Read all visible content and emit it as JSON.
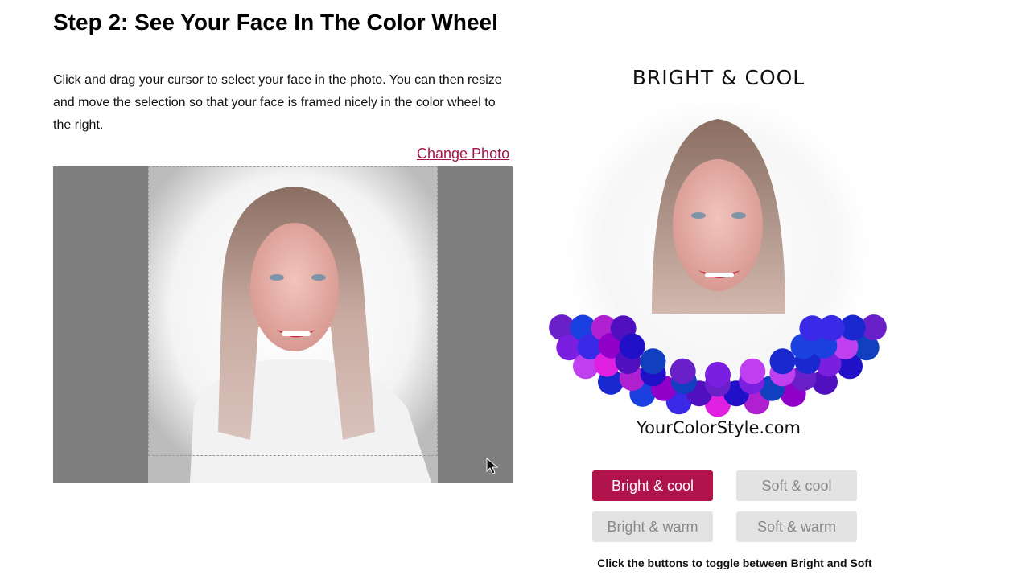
{
  "header": {
    "title": "Step 2: See Your Face In The Color Wheel",
    "instructions": "Click and drag your cursor to select your face in the photo. You can then resize and move the selection so that your face is framed nicely in the color wheel to the right."
  },
  "photo": {
    "change_label": "Change Photo"
  },
  "wheel": {
    "title": "BRIGHT & COOL",
    "site": "YourColorStyle.com",
    "swatch_colors": [
      "#6a20c8",
      "#7a1ee0",
      "#c040f0",
      "#1a28d0",
      "#1a40e0",
      "#3a2ae8",
      "#e020e0",
      "#b020d0",
      "#9000c8",
      "#5010c0",
      "#2010c8",
      "#1040c0"
    ]
  },
  "buttons": {
    "bright_cool": "Bright & cool",
    "soft_cool": "Soft & cool",
    "bright_warm": "Bright & warm",
    "soft_warm": "Soft & warm"
  },
  "hint": "Click the buttons to toggle between Bright and Soft",
  "colors": {
    "accent": "#b0124a",
    "link": "#a3154a",
    "inactive_button": "#e3e3e3"
  }
}
